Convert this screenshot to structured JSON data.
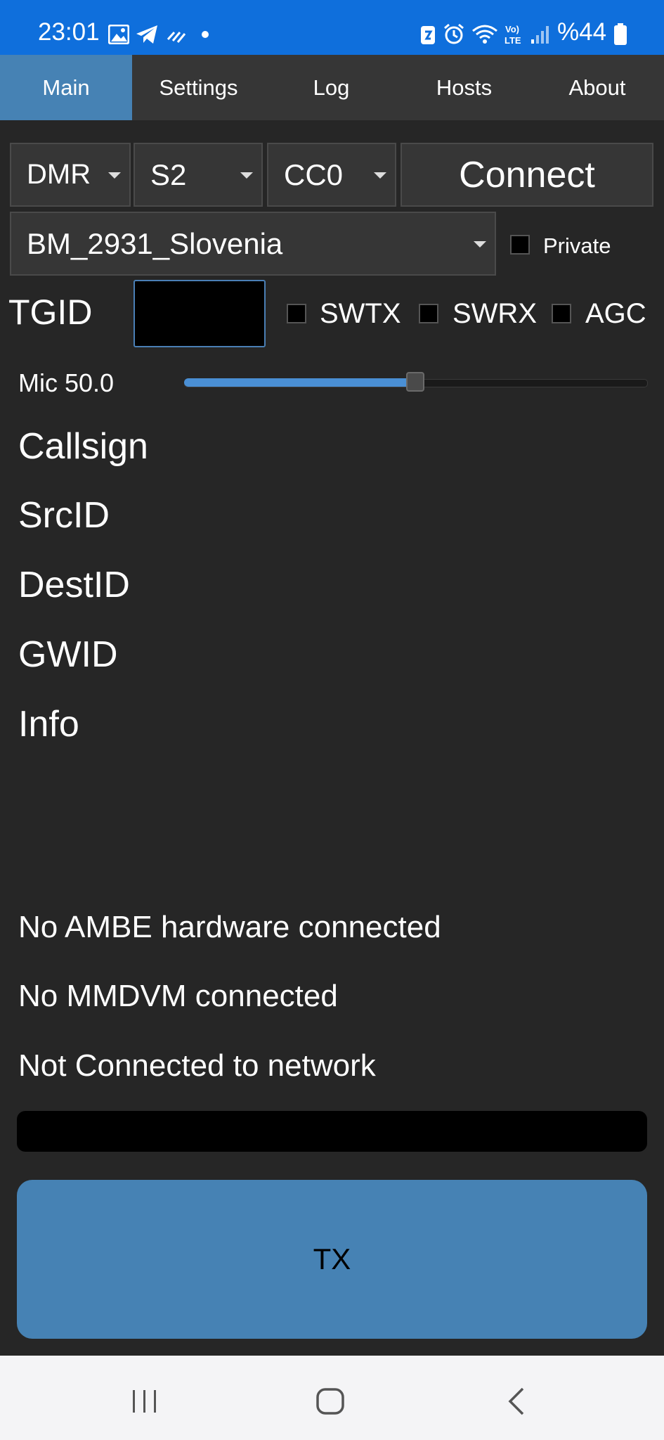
{
  "status_bar": {
    "time": "23:01",
    "battery": "%44",
    "icons": [
      "image-icon",
      "telegram-icon",
      "app-icon",
      "dot-icon",
      "battery-saver-icon",
      "alarm-icon",
      "wifi-icon",
      "volte-icon",
      "signal-icon",
      "battery-icon"
    ]
  },
  "tabs": [
    {
      "label": "Main",
      "active": true
    },
    {
      "label": "Settings",
      "active": false
    },
    {
      "label": "Log",
      "active": false
    },
    {
      "label": "Hosts",
      "active": false
    },
    {
      "label": "About",
      "active": false
    }
  ],
  "controls": {
    "mode": "DMR",
    "slot": "S2",
    "color_code": "CC0",
    "connect_label": "Connect",
    "host": "BM_2931_Slovenia",
    "private_label": "Private",
    "tgid_label": "TGID",
    "tgid_value": "",
    "swtx_label": "SWTX",
    "swrx_label": "SWRX",
    "agc_label": "AGC",
    "mic_label": "Mic 50.0",
    "mic_level": 0.5
  },
  "info": {
    "callsign": "Callsign",
    "srcid": "SrcID",
    "destid": "DestID",
    "gwid": "GWID",
    "info": "Info"
  },
  "status": {
    "ambe": "No AMBE hardware connected",
    "mmdvm": "No MMDVM connected",
    "network": "Not Connected to network"
  },
  "tx_label": "TX",
  "colors": {
    "status_bar": "#0f6fdc",
    "accent": "#4682b4",
    "background": "#262626"
  }
}
